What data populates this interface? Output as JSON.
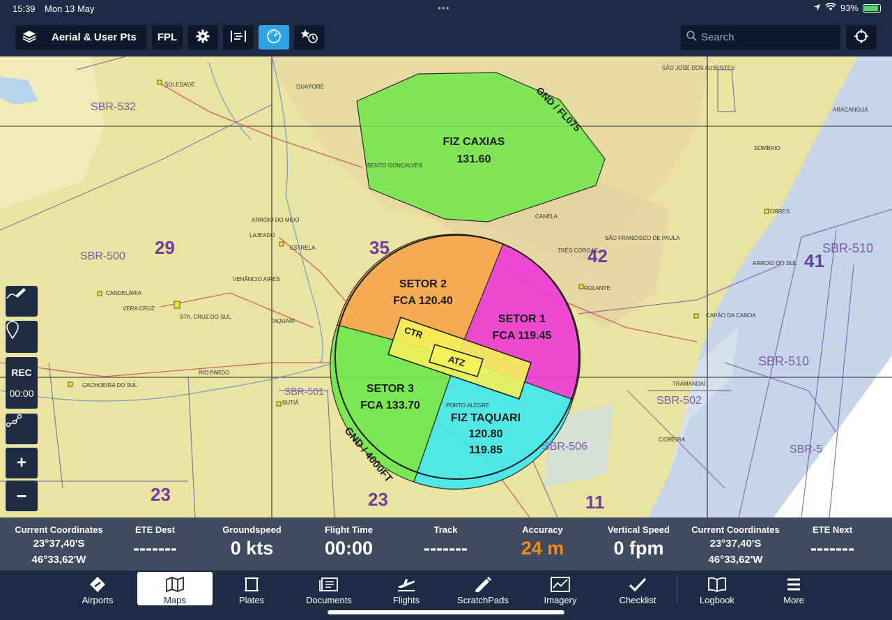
{
  "status": {
    "time": "15:39",
    "date": "Mon 13 May",
    "battery": "93%",
    "battery_level": 0.93
  },
  "toolbar": {
    "layers_label": "Aerial & User Pts",
    "fpl_label": "FPL",
    "search_placeholder": "Search"
  },
  "map": {
    "fiz_caxias": {
      "name": "FIZ CAXIAS",
      "freq": "131.60"
    },
    "gnd_fl075": "GND / FL075",
    "setor2": {
      "name": "SETOR 2",
      "freq": "FCA 120.40"
    },
    "setor1": {
      "name": "SETOR 1",
      "freq": "FCA 119.45"
    },
    "setor3": {
      "name": "SETOR 3",
      "freq": "FCA 133.70"
    },
    "fiz_taquari": {
      "name": "FIZ TAQUARI",
      "freq1": "120.80",
      "freq2": "119.85"
    },
    "ctr": "CTR",
    "atz": "ATZ",
    "gnd_4000": "GND / 4000FT",
    "sbr_labels": [
      "SBR-532",
      "SBR-500",
      "SBR-501",
      "SBR-506",
      "SBR-510",
      "SBR-510",
      "SBR-502",
      "SBR-5"
    ],
    "grid_numbers": [
      "29",
      "35",
      "42",
      "41",
      "23",
      "23",
      "11"
    ],
    "places": [
      "SOLEDADE",
      "CANDELÁRIA",
      "STA. CRUZ DO SUL",
      "CACHOEIRA DO SUL",
      "RIO PARDO",
      "BUTIÁ",
      "ESTRELA",
      "LAJEADO",
      "ARROIO DO MEIO",
      "CANELA",
      "TRÊS COROAS",
      "ROLANTE",
      "CAPÃO DA CANOA",
      "TORRES",
      "SÃO FRANCISCO DE PAULA",
      "VERA CRUZ",
      "TAQUARI",
      "VENÂNCIO AIRES",
      "GUAPORÉ",
      "BENTO GONÇALVES",
      "SÃO JOSÉ DOS AUSENTES",
      "ARAÇANGUÁ",
      "SOMBRIO",
      "ARROIO DO SUL",
      "TRAMANDAÍ",
      "CIDREIRA",
      "PORTO ALEGRE"
    ]
  },
  "left_controls": {
    "rec": "REC",
    "rec_time": "00:00"
  },
  "info": [
    {
      "label": "Current Coordinates",
      "lat": "23°37,40'S",
      "lon": "46°33,62'W"
    },
    {
      "label": "ETE Dest",
      "value": "-------"
    },
    {
      "label": "Groundspeed",
      "value": "0 kts"
    },
    {
      "label": "Flight Time",
      "value": "00:00"
    },
    {
      "label": "Track",
      "value": "-------"
    },
    {
      "label": "Accuracy",
      "value": "24 m"
    },
    {
      "label": "Vertical Speed",
      "value": "0 fpm"
    },
    {
      "label": "Current Coordinates",
      "lat": "23°37,40'S",
      "lon": "46°33,62'W"
    },
    {
      "label": "ETE Next",
      "value": "-------"
    }
  ],
  "tabs": [
    "Airports",
    "Maps",
    "Plates",
    "Documents",
    "Flights",
    "ScratchPads",
    "Imagery",
    "Checklist",
    "Logbook",
    "More"
  ],
  "colors": {
    "accent": "#2ea3e8",
    "accuracy": "#f08a1c",
    "fiz_caxias": "#6ee84a",
    "setor2": "#f6a54a",
    "setor1": "#ec38d6",
    "setor3": "#6ee84a",
    "fiz_taquari": "#3ee8ec",
    "ctr": "#f4f25a"
  }
}
